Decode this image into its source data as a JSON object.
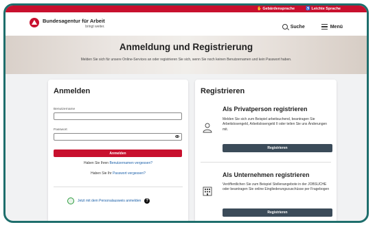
{
  "topbar": {
    "sign_language": "Gebärdensprache",
    "easy_language": "Leichte Sprache"
  },
  "header": {
    "brand_name": "Bundesagentur für Arbeit",
    "brand_tagline": "bringt weiter.",
    "search_label": "Suche",
    "menu_label": "Menü"
  },
  "hero": {
    "title": "Anmeldung und Registrierung",
    "subtitle": "Melden Sie sich für unsere Online-Services an oder registrieren Sie sich, wenn Sie noch keinen Benutzernamen und kein Passwort haben."
  },
  "login": {
    "title": "Anmelden",
    "username_label": "Benutzername",
    "username_value": "",
    "password_label": "Passwort",
    "password_value": "",
    "submit_label": "Anmelden",
    "forgot_user_prefix": "Haben Sie Ihren ",
    "forgot_user_link": "Benutzernamen vergessen?",
    "forgot_pw_prefix": "Haben Sie Ihr ",
    "forgot_pw_link": "Passwort vergessen?",
    "ausweis_link": "Jetzt mit dem Personalausweis anmelden",
    "help_glyph": "?"
  },
  "register": {
    "title": "Registrieren",
    "private": {
      "heading": "Als Privatperson registrieren",
      "text": "Melden Sie sich zum Beispiel arbeitsuchend, beantragen Sie Arbeitslosengeld, Arbeitslosengeld II oder teilen Sie uns Änderungen mit.",
      "button": "Registrieren"
    },
    "business": {
      "heading": "Als Unternehmen registrieren",
      "text": "Veröffentlichen Sie zum Beispiel Stellenangebote in der JOBSUCHE oder beantragen Sie online Eingliederungszuschüsse per Fragebogen",
      "button": "Registrieren"
    }
  },
  "colors": {
    "brand_red": "#c8102e",
    "button_gray": "#3b4b59",
    "frame_teal": "#1e6e6c",
    "link_blue": "#1a5fa8"
  }
}
